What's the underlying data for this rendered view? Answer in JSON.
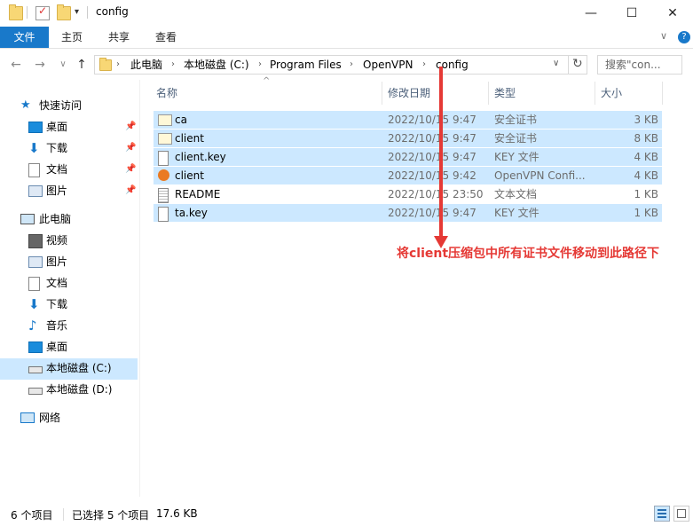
{
  "window": {
    "title": "config",
    "minimize_glyph": "—",
    "maximize_glyph": "☐",
    "close_glyph": "✕"
  },
  "ribbon": {
    "tabs": [
      "文件",
      "主页",
      "共享",
      "查看"
    ],
    "expand_glyph": "∨",
    "help_glyph": "?"
  },
  "address": {
    "back_glyph": "←",
    "forward_glyph": "→",
    "recent_glyph": "∨",
    "up_glyph": "↑",
    "crumbs": [
      "此电脑",
      "本地磁盘 (C:)",
      "Program Files",
      "OpenVPN",
      "config"
    ],
    "separator": "›",
    "dropdown_glyph": "∨",
    "refresh_glyph": "↻"
  },
  "search": {
    "placeholder": "搜索\"con..."
  },
  "nav": {
    "quick_access": "快速访问",
    "quick_items": [
      "桌面",
      "下载",
      "文档",
      "图片"
    ],
    "this_pc": "此电脑",
    "pc_items": [
      "视频",
      "图片",
      "文档",
      "下载",
      "音乐",
      "桌面",
      "本地磁盘 (C:)",
      "本地磁盘 (D:)"
    ],
    "network": "网络"
  },
  "columns": {
    "name": "名称",
    "date": "修改日期",
    "type": "类型",
    "size": "大小",
    "sort_glyph": "^"
  },
  "files": [
    {
      "name": "ca",
      "date": "2022/10/15 9:47",
      "type": "安全证书",
      "size": "3 KB",
      "selected": true,
      "icon": "certificate-icon"
    },
    {
      "name": "client",
      "date": "2022/10/15 9:47",
      "type": "安全证书",
      "size": "8 KB",
      "selected": true,
      "icon": "certificate-icon"
    },
    {
      "name": "client.key",
      "date": "2022/10/15 9:47",
      "type": "KEY 文件",
      "size": "4 KB",
      "selected": true,
      "icon": "blank-file-icon"
    },
    {
      "name": "client",
      "date": "2022/10/15 9:42",
      "type": "OpenVPN Confi...",
      "size": "4 KB",
      "selected": true,
      "icon": "openvpn-config-icon"
    },
    {
      "name": "README",
      "date": "2022/10/15 23:50",
      "type": "文本文档",
      "size": "1 KB",
      "selected": false,
      "icon": "text-file-icon"
    },
    {
      "name": "ta.key",
      "date": "2022/10/15 9:47",
      "type": "KEY 文件",
      "size": "1 KB",
      "selected": true,
      "icon": "blank-file-icon"
    }
  ],
  "annotation": {
    "text": "将client压缩包中所有证书文件移动到此路径下",
    "color": "#e53935"
  },
  "status": {
    "count": "6 个项目",
    "selected": "已选择 5 个项目",
    "size": "17.6 KB"
  },
  "colors": {
    "accent": "#1979ca",
    "selection": "#cce8ff"
  }
}
